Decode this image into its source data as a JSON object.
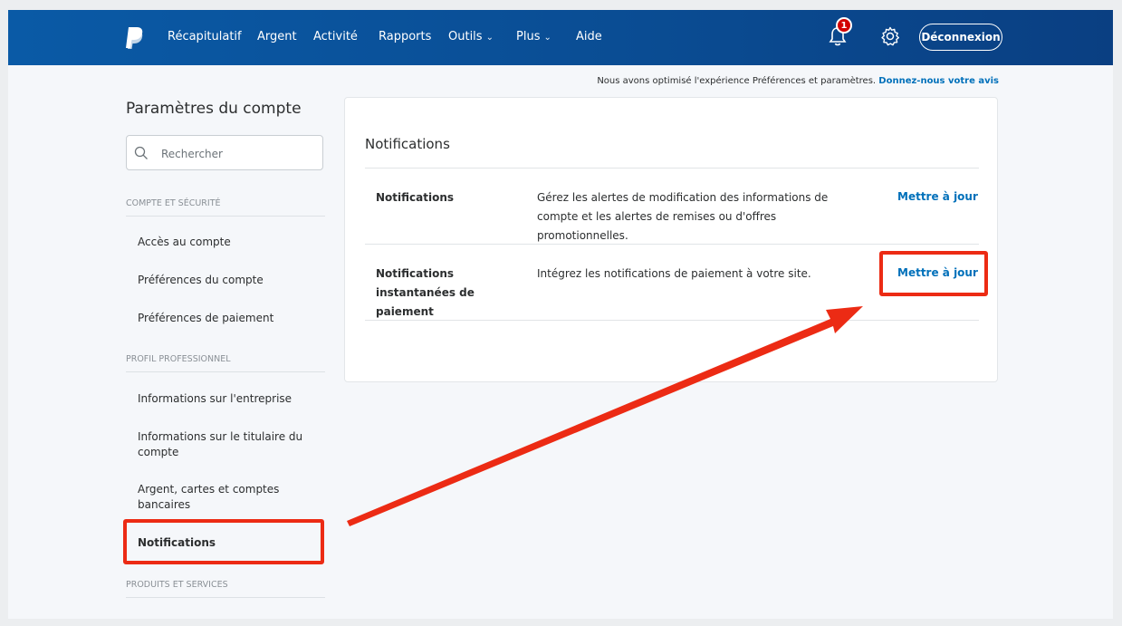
{
  "nav": {
    "items": [
      "Récapitulatif",
      "Argent",
      "Activité",
      "Rapports",
      "Outils",
      "Plus",
      "Aide"
    ],
    "notification_count": "1",
    "logout_label": "Déconnexion"
  },
  "banner": {
    "text": "Nous avons optimisé l'expérience Préférences et paramètres.",
    "link": "Donnez-nous votre avis"
  },
  "sidebar": {
    "title": "Paramètres du compte",
    "search_placeholder": "Rechercher",
    "sections": [
      {
        "heading": "COMPTE ET SÉCURITÉ",
        "items": [
          "Accès au compte",
          "Préférences du compte",
          "Préférences de paiement"
        ]
      },
      {
        "heading": "PROFIL PROFESSIONNEL",
        "items": [
          "Informations sur l'entreprise",
          "Informations sur le titulaire du compte",
          "Argent, cartes et comptes bancaires",
          "Notifications"
        ]
      },
      {
        "heading": "PRODUITS ET SERVICES",
        "items": []
      }
    ]
  },
  "main": {
    "title": "Notifications",
    "rows": [
      {
        "label": "Notifications",
        "description": "Gérez les alertes de modification des informations de compte et les alertes de remises ou d'offres promotionnelles.",
        "action": "Mettre à jour"
      },
      {
        "label": "Notifications instantanées de paiement",
        "description": "Intégrez les notifications de paiement à votre site.",
        "action": "Mettre à jour"
      }
    ]
  },
  "colors": {
    "nav_bg": "#0a4d94",
    "link": "#0070ba",
    "highlight": "#ec2b14"
  }
}
